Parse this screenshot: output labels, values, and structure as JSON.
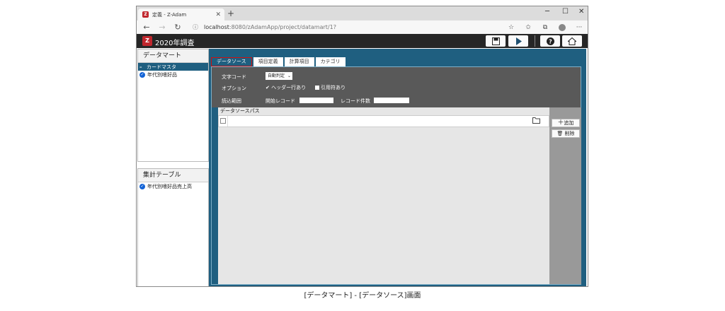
{
  "browser": {
    "tab_title": "定義 - Z-Adam",
    "url_host": "localhost",
    "url_path": ":8080/zAdamApp/project/datamart/1?"
  },
  "app": {
    "title": "2020年調査"
  },
  "left": {
    "datamart_header": "データマート",
    "datamart_items": [
      "カードマスタ",
      "年代別嗜好品"
    ],
    "table_header": "集計テーブル",
    "table_items": [
      "年代別嗜好品売上高"
    ]
  },
  "main": {
    "tabs": [
      "データソース",
      "項目定義",
      "計算項目",
      "カテゴリ"
    ],
    "charcode_label": "文字コード",
    "charcode_value": "自動判定",
    "option_label": "オプション",
    "header_row": "ヘッダー行あり",
    "quote": "引用符あり",
    "range_label": "読込範囲",
    "start_record": "開始レコード",
    "record_count": "レコード件数",
    "datasource_path": "データソースパス",
    "add_button": "追加",
    "delete_button": "削除"
  },
  "caption": "[データマート] - [データソース]画面",
  "colors": {
    "accent": "#1f5f80",
    "brand": "#c0262d",
    "dark": "#595959"
  }
}
